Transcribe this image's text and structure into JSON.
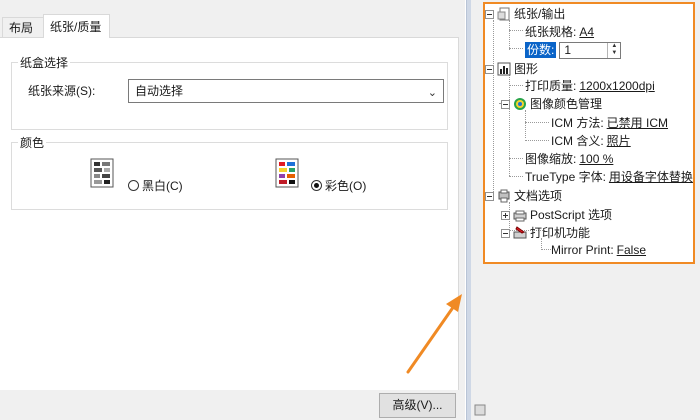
{
  "tabs": [
    {
      "label": "布局"
    },
    {
      "label": "纸张/质量"
    }
  ],
  "paper_source_group": {
    "title": "纸盒选择",
    "source_label": "纸张来源(S):",
    "source_value": "自动选择"
  },
  "color_group": {
    "title": "颜色",
    "bw_label": "黑白(C)",
    "color_label": "彩色(O)",
    "selected": "color"
  },
  "advanced_button": {
    "label": "高级(V)..."
  },
  "tree": {
    "paper_output": {
      "label": "纸张/输出"
    },
    "paper_size": {
      "label": "纸张规格:",
      "value": "A4"
    },
    "copies": {
      "label": "份数:",
      "value": "1"
    },
    "graphics": {
      "label": "图形"
    },
    "print_quality": {
      "label": "打印质量:",
      "value": "1200x1200dpi"
    },
    "image_color_mgmt": {
      "label": "图像颜色管理"
    },
    "icm_method": {
      "label": "ICM 方法:",
      "value": "已禁用 ICM"
    },
    "icm_intent": {
      "label": "ICM 含义:",
      "value": "照片"
    },
    "scaling": {
      "label": "图像缩放:",
      "value": "100 %"
    },
    "truetype": {
      "label": "TrueType 字体:",
      "value": "用设备字体替换"
    },
    "document_options": {
      "label": "文档选项"
    },
    "postscript": {
      "label": "PostScript 选项"
    },
    "printer_features": {
      "label": "打印机功能"
    },
    "mirror_print": {
      "label": "Mirror Print:",
      "value": "False"
    }
  },
  "colors": {
    "highlight_border": "#f08a24",
    "arrow": "#f08a24",
    "selection": "#0a64c8"
  }
}
